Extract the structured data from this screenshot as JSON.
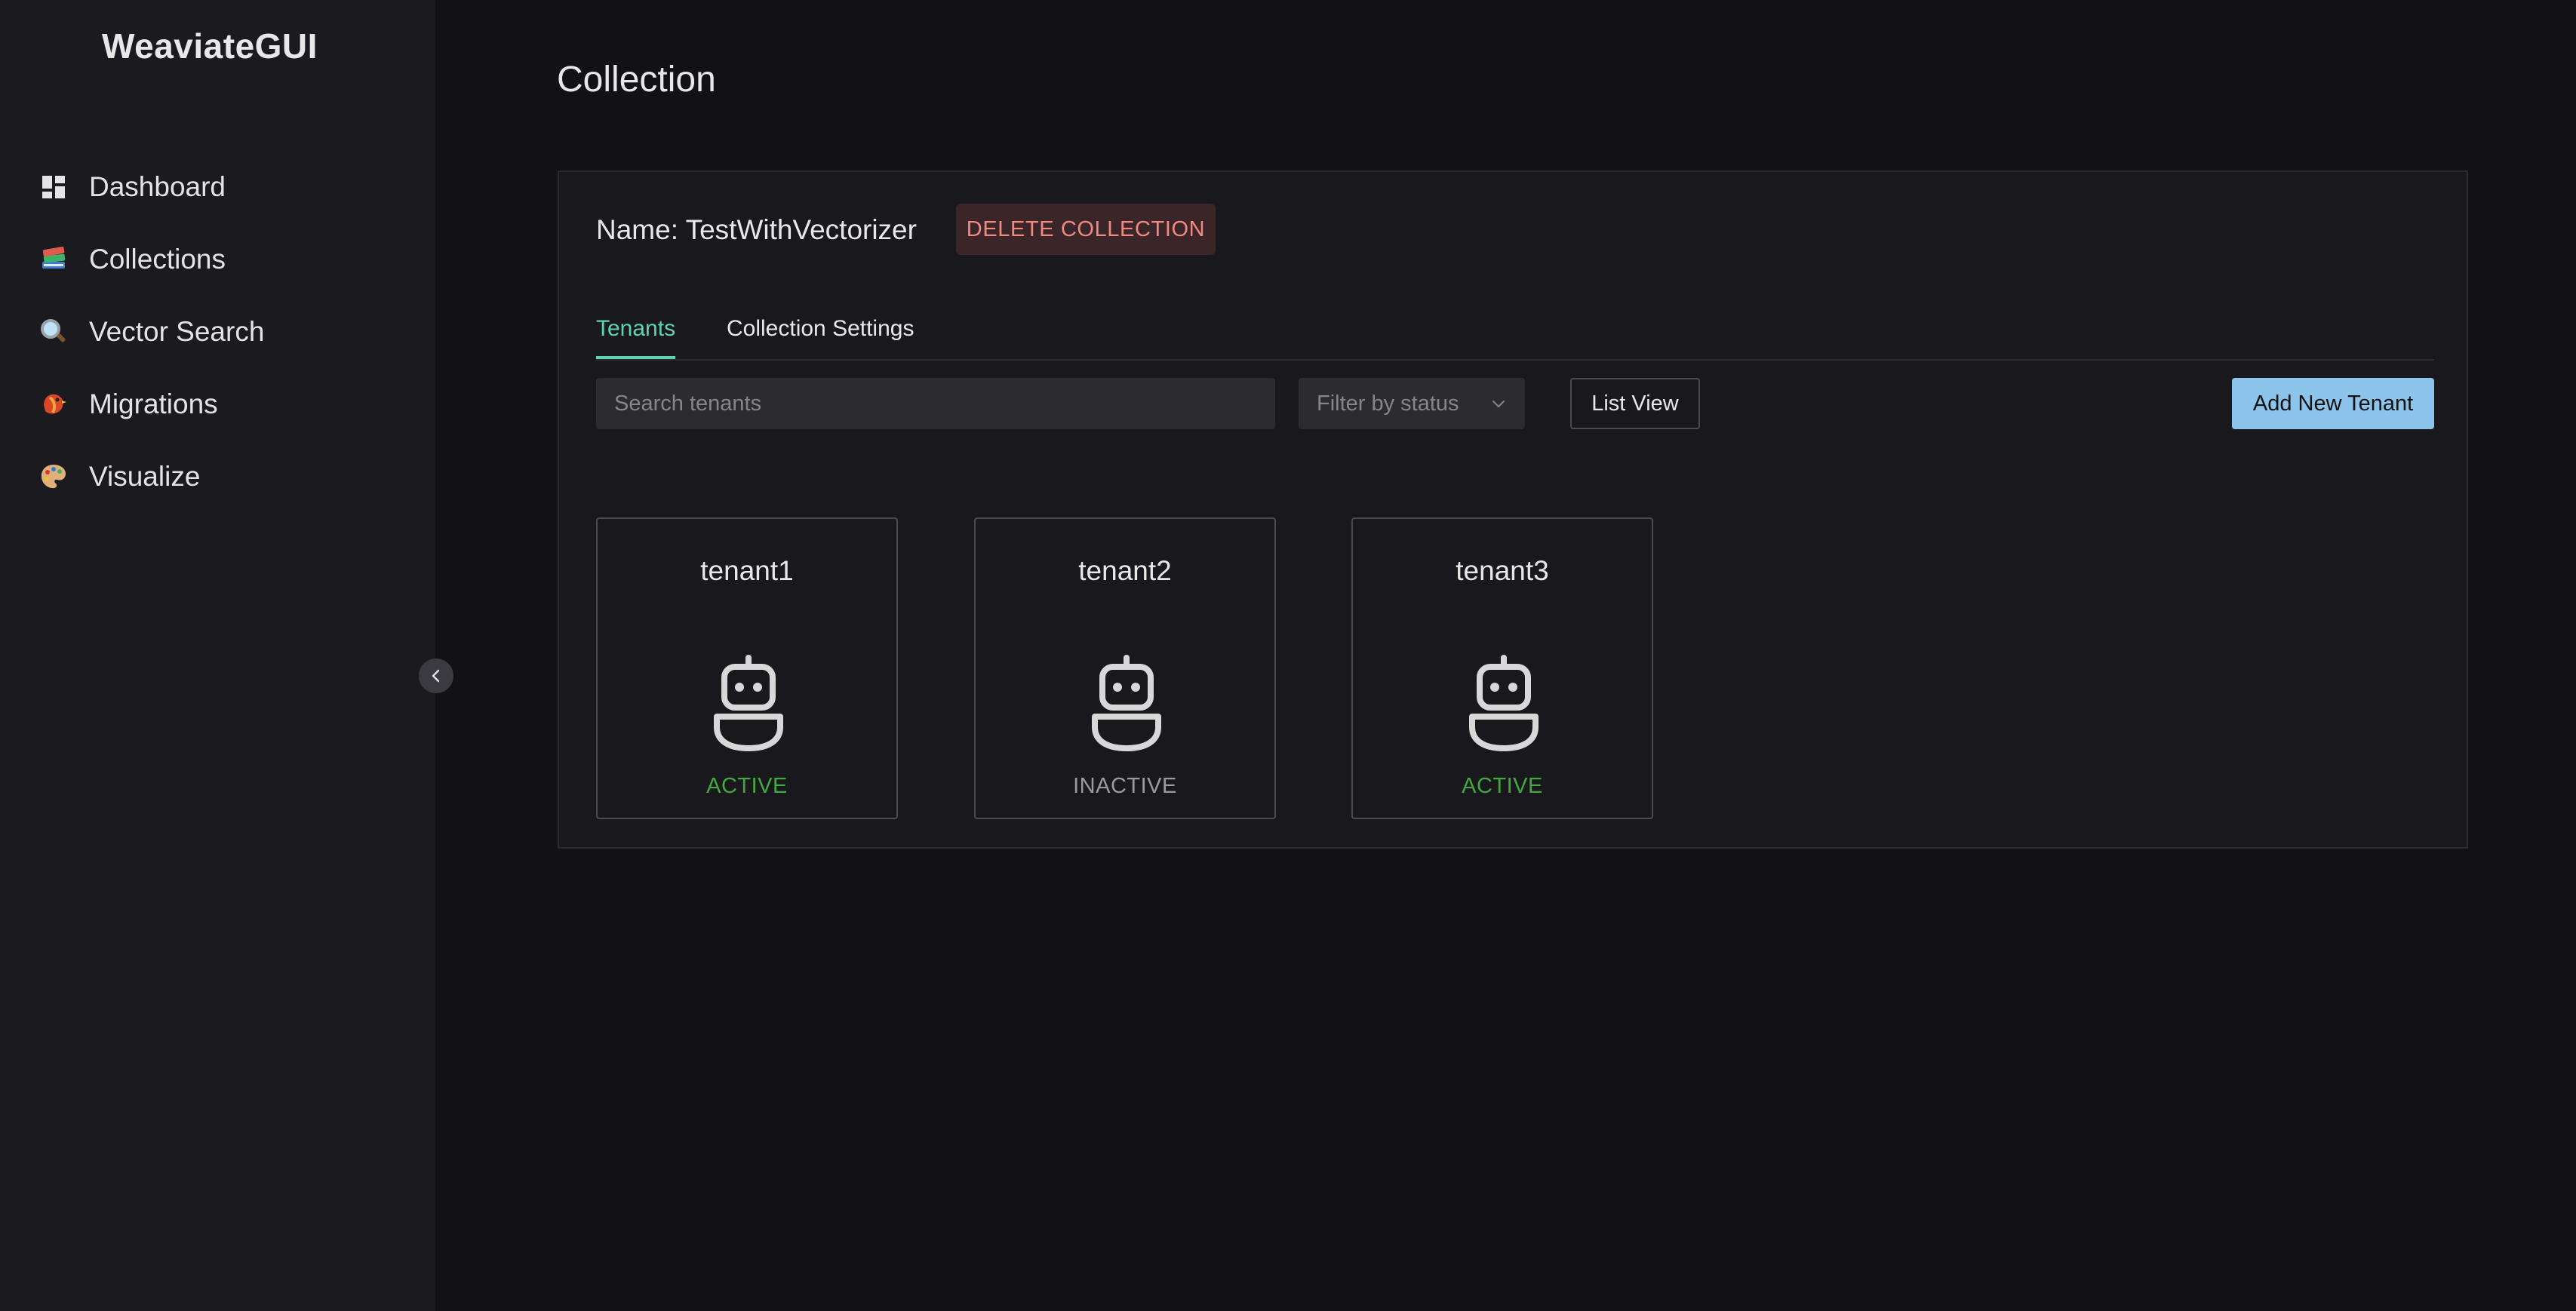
{
  "app": {
    "brand": "WeaviateGUI"
  },
  "sidebar": {
    "items": [
      {
        "label": "Dashboard",
        "icon": "dashboard-icon"
      },
      {
        "label": "Collections",
        "icon": "books-icon"
      },
      {
        "label": "Vector Search",
        "icon": "magnifier-icon"
      },
      {
        "label": "Migrations",
        "icon": "bird-icon"
      },
      {
        "label": "Visualize",
        "icon": "palette-icon"
      }
    ],
    "collapse_icon": "chevron-left-icon"
  },
  "page": {
    "title": "Collection"
  },
  "collection": {
    "name_text": "Name: TestWithVectorizer",
    "delete_label": "DELETE COLLECTION",
    "tabs": [
      {
        "label": "Tenants",
        "active": true
      },
      {
        "label": "Collection Settings",
        "active": false
      }
    ],
    "search_placeholder": "Search tenants",
    "filter_placeholder": "Filter by status",
    "list_view_label": "List View",
    "add_tenant_label": "Add New Tenant"
  },
  "tenants": [
    {
      "name": "tenant1",
      "status": "ACTIVE"
    },
    {
      "name": "tenant2",
      "status": "INACTIVE"
    },
    {
      "name": "tenant3",
      "status": "ACTIVE"
    }
  ],
  "colors": {
    "background": "#111116",
    "sidebar": "#1a1a1f",
    "accent_tab": "#5fd3ad",
    "delete_text": "#f08a80",
    "delete_bg": "#3a2629",
    "primary_button": "#8cc4ec",
    "active_status": "#43a83f",
    "inactive_status": "#9a9aa0"
  }
}
